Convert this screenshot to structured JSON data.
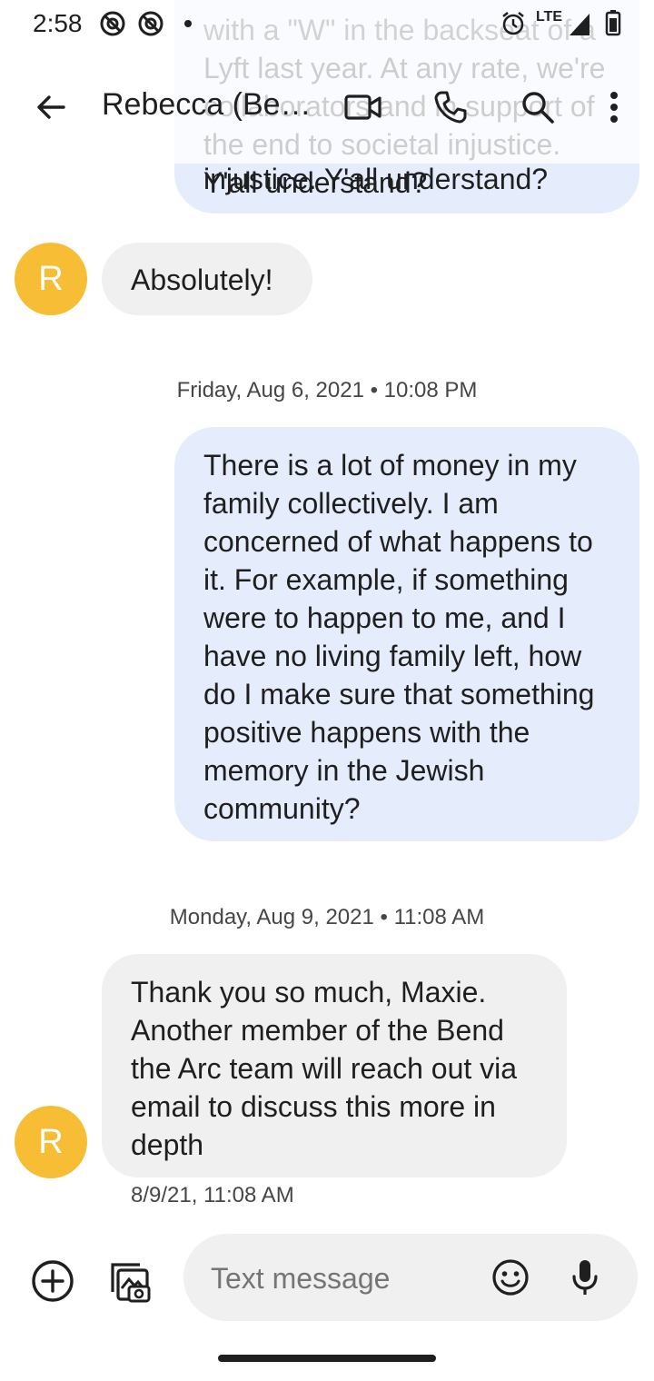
{
  "status_bar": {
    "time": "2:58",
    "lte": "LTE"
  },
  "header": {
    "title": "Rebecca (Be…"
  },
  "messages": {
    "prev_out_ghost": "with a \"W\" in the backseat of a Lyft last year. At any rate, we're collaborators and in support of the end to societal injustice. Y'all understand?",
    "prev_out_visible": "injustice. Y'all understand?",
    "in1": "Absolutely!",
    "date1": "Friday, Aug 6, 2021 • 10:08 PM",
    "out2": "There is a lot of money in my family collectively. I am concerned of what happens to it. For example, if something were to happen to me, and I have no living family left, how do I make sure that something positive happens with the memory in the Jewish community?",
    "date2": "Monday, Aug 9, 2021 • 11:08 AM",
    "in2": "Thank you so much, Maxie. Another member of the Bend the Arc team will reach out via email to discuss this more in depth",
    "in2_timestamp": "8/9/21, 11:08 AM",
    "avatar_letter": "R"
  },
  "composer": {
    "placeholder": "Text message"
  },
  "colors": {
    "outgoing_bubble": "#e5ecfb",
    "incoming_bubble": "#f0f0f0",
    "avatar": "#f7bd34",
    "composer_bg": "#f0f0f0"
  },
  "icons": [
    "alarm-icon",
    "signal-icon",
    "battery-icon",
    "back-arrow-icon",
    "video-call-icon",
    "phone-icon",
    "search-icon",
    "more-vert-icon",
    "add-icon",
    "gallery-icon",
    "emoji-icon",
    "mic-icon"
  ]
}
